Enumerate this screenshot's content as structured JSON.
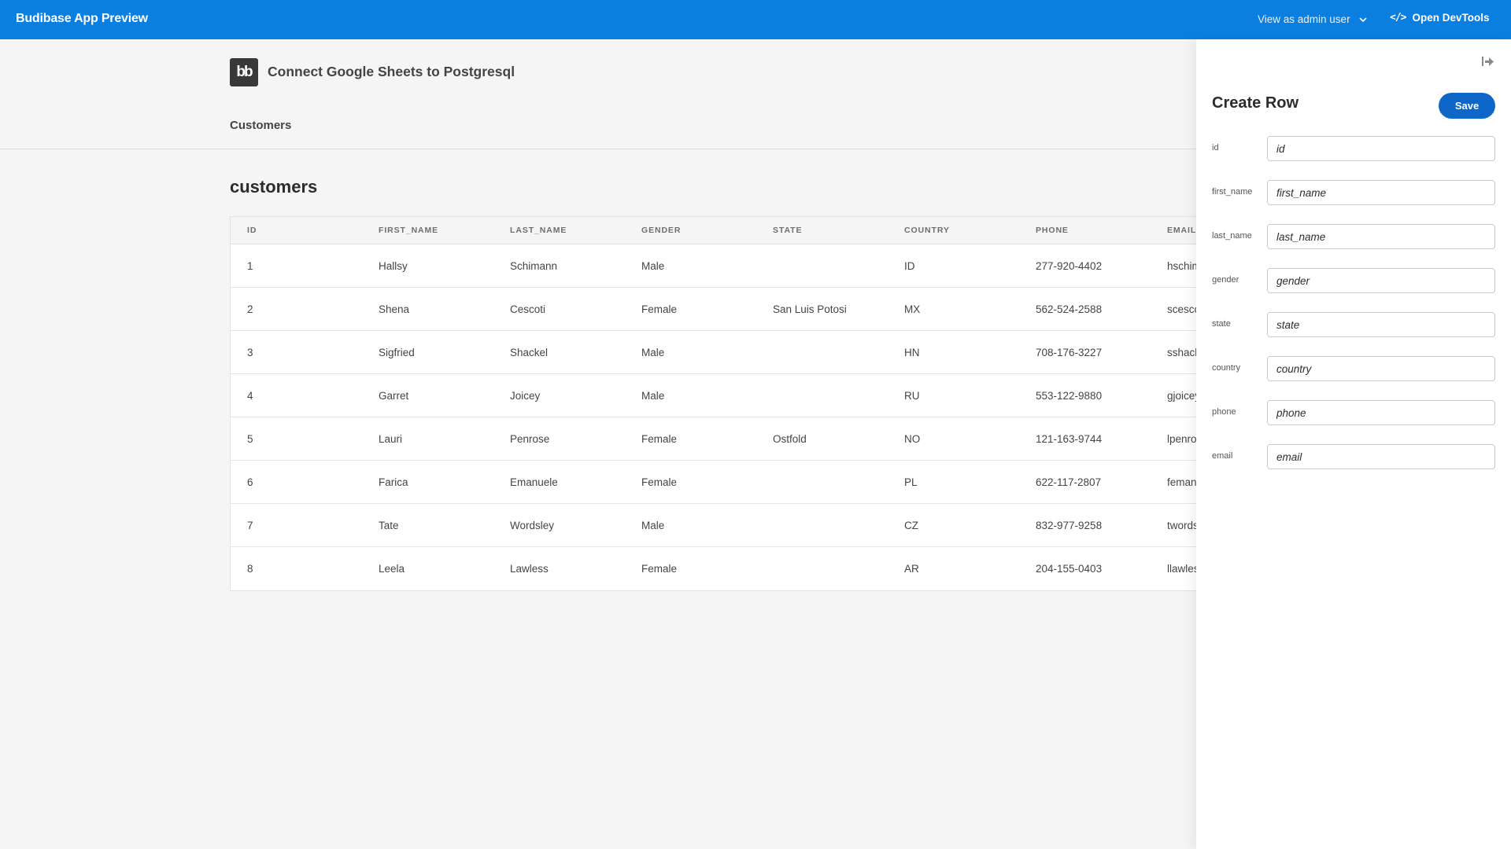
{
  "topbar": {
    "title": "Budibase App Preview",
    "view_as": "View as admin user",
    "devtools_icon": "</>",
    "devtools_label": "Open DevTools",
    "background": "#0a7fe0"
  },
  "header": {
    "logo_text": "bb",
    "site_title": "Connect Google Sheets to Postgresql",
    "nav": [
      {
        "label": "Customers"
      }
    ]
  },
  "main": {
    "section_title": "customers",
    "table": {
      "columns": [
        "ID",
        "FIRST_NAME",
        "LAST_NAME",
        "GENDER",
        "STATE",
        "COUNTRY",
        "PHONE",
        "EMAIL"
      ],
      "rows": [
        [
          "1",
          "Hallsy",
          "Schimann",
          "Male",
          "",
          "ID",
          "277-920-4402",
          "hschima"
        ],
        [
          "2",
          "Shena",
          "Cescoti",
          "Female",
          "San Luis Potosi",
          "MX",
          "562-524-2588",
          "scescot"
        ],
        [
          "3",
          "Sigfried",
          "Shackel",
          "Male",
          "",
          "HN",
          "708-176-3227",
          "sshacke"
        ],
        [
          "4",
          "Garret",
          "Joicey",
          "Male",
          "",
          "RU",
          "553-122-9880",
          "gjoicey"
        ],
        [
          "5",
          "Lauri",
          "Penrose",
          "Female",
          "Ostfold",
          "NO",
          "121-163-9744",
          "lpenros"
        ],
        [
          "6",
          "Farica",
          "Emanuele",
          "Female",
          "",
          "PL",
          "622-117-2807",
          "femanu"
        ],
        [
          "7",
          "Tate",
          "Wordsley",
          "Male",
          "",
          "CZ",
          "832-977-9258",
          "twordsl"
        ],
        [
          "8",
          "Leela",
          "Lawless",
          "Female",
          "",
          "AR",
          "204-155-0403",
          "llawless"
        ]
      ]
    }
  },
  "panel": {
    "heading": "Create Row",
    "save_label": "Save",
    "save_color": "#0e66c9",
    "fields": [
      {
        "label": "id",
        "placeholder": "id"
      },
      {
        "label": "first_name",
        "placeholder": "first_name"
      },
      {
        "label": "last_name",
        "placeholder": "last_name"
      },
      {
        "label": "gender",
        "placeholder": "gender"
      },
      {
        "label": "state",
        "placeholder": "state"
      },
      {
        "label": "country",
        "placeholder": "country"
      },
      {
        "label": "phone",
        "placeholder": "phone"
      },
      {
        "label": "email",
        "placeholder": "email"
      }
    ]
  }
}
